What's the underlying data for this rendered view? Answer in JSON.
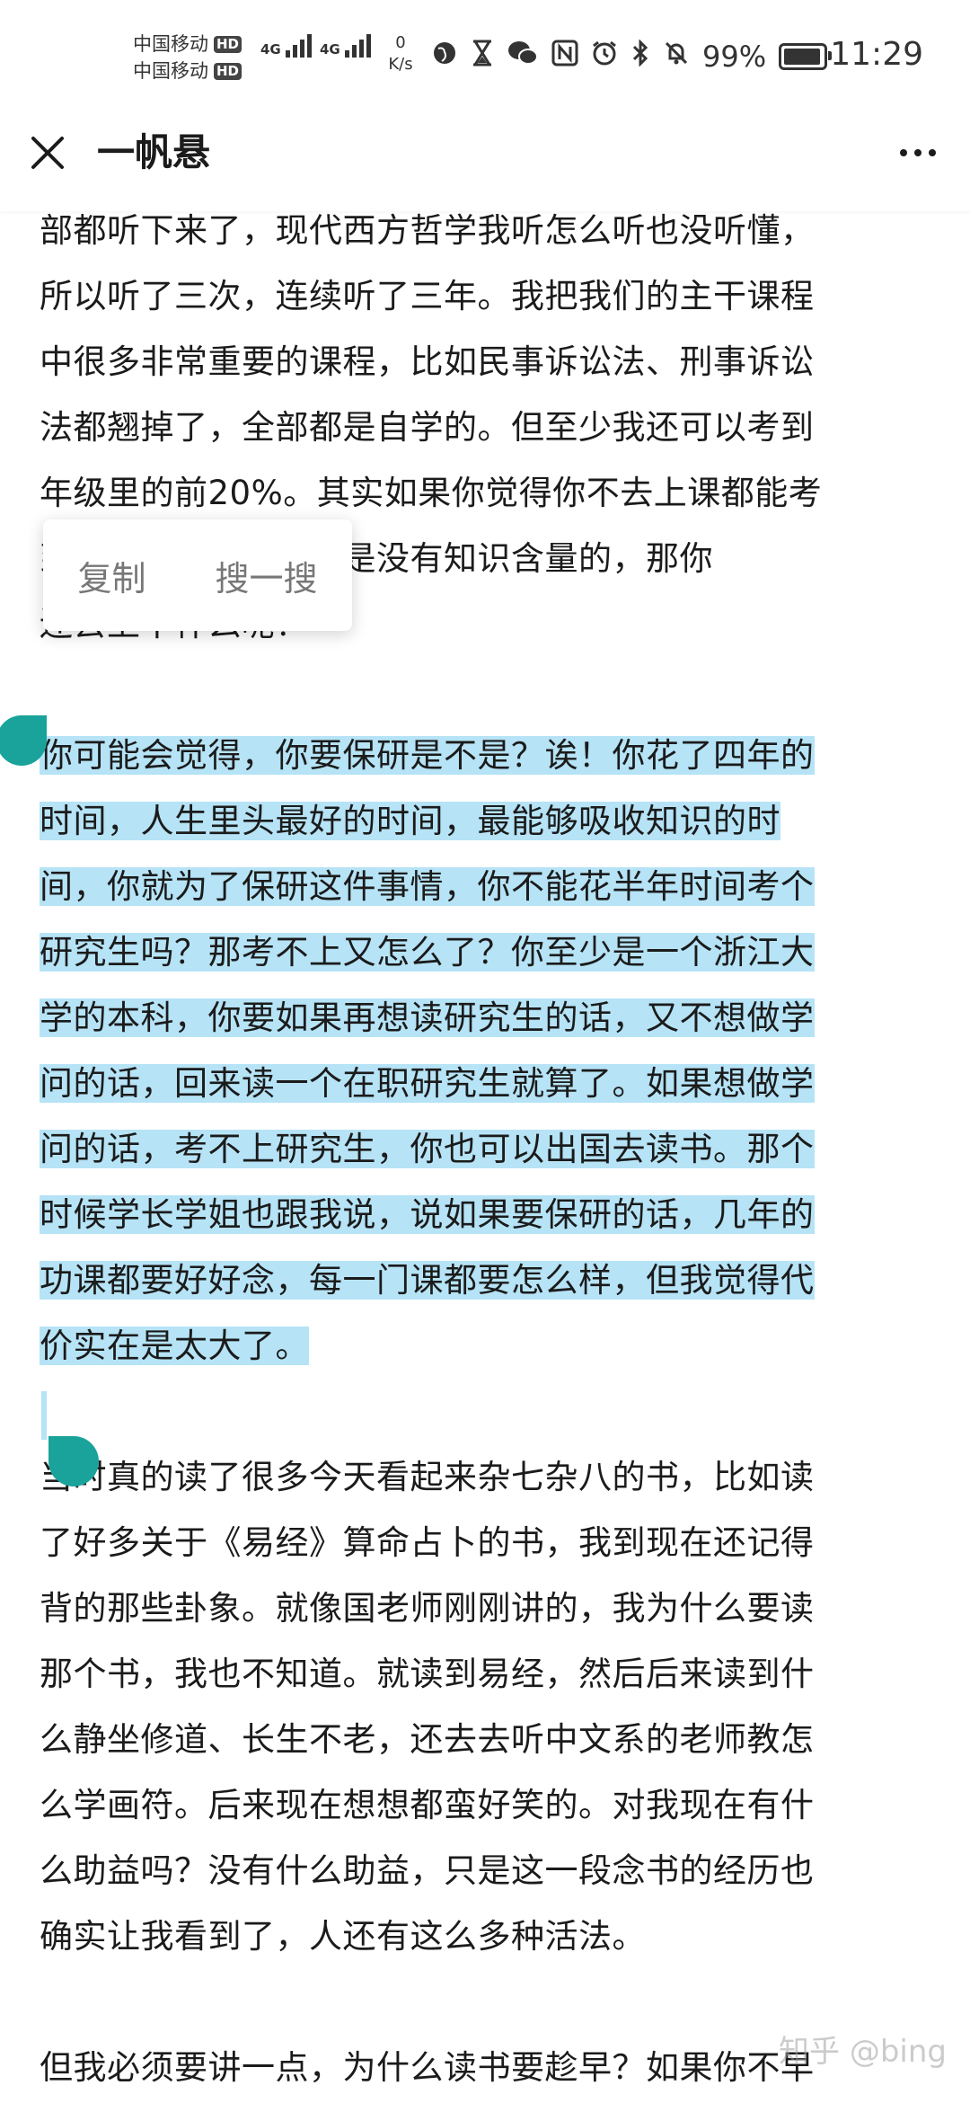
{
  "status_bar": {
    "carrier_1": "中国移动",
    "carrier_2": "中国移动",
    "hd": "HD",
    "network_1": "4G",
    "network_2": "4G",
    "speed_value": "0",
    "speed_unit": "K/s",
    "battery_percent": "99%",
    "battery_level": 0.99,
    "time": "11:29"
  },
  "app_bar": {
    "title": "一帆悬"
  },
  "context_menu": {
    "copy_label": "复制",
    "search_label": "搜一搜"
  },
  "article": {
    "para_1": "部都听下来了，现代西方哲学我听怎么听也没听懂，\n所以听了三次，连续听了三年。我把我们的主干课程\n中很多非常重要的课程，比如民事诉讼法、刑事诉讼\n法都翘掉了，全部都是自学的。但至少我还可以考到\n年级里的前20%。其实如果你觉得你不去上课都能考\n到的话，那这门课就是没有知识含量的，那你\n还去上干什么呢？",
    "para_2": "你可能会觉得，你要保研是不是？诶！你花了四年的\n时间，人生里头最好的时间，最能够吸收知识的时\n间，你就为了保研这件事情，你不能花半年时间考个\n研究生吗？那考不上又怎么了？你至少是一个浙江大\n学的本科，你要如果再想读研究生的话，又不想做学\n问的话，回来读一个在职研究生就算了。如果想做学\n问的话，考不上研究生，你也可以出国去读书。那个\n时候学长学姐也跟我说，说如果要保研的话，几年的\n功课都要好好念，每一门课都要怎么样，但我觉得代\n价实在是太大了。",
    "para_3": "当时真的读了很多今天看起来杂七杂八的书，比如读\n了好多关于《易经》算命占卜的书，我到现在还记得\n背的那些卦象。就像国老师刚刚讲的，我为什么要读\n那个书，我也不知道。就读到易经，然后后来读到什\n么静坐修道、长生不老，还去去听中文系的老师教怎\n么学画符。后来现在想想都蛮好笑的。对我现在有什\n么助益吗？没有什么助益，只是这一段念书的经历也\n确实让我看到了，人还有这么多种活法。",
    "para_4": "但我必须要讲一点，为什么读书要趁早？如果你不早"
  },
  "watermark": "知乎 @bing",
  "colors": {
    "selection": "#b6e3f6",
    "handle": "#1aa39a"
  }
}
